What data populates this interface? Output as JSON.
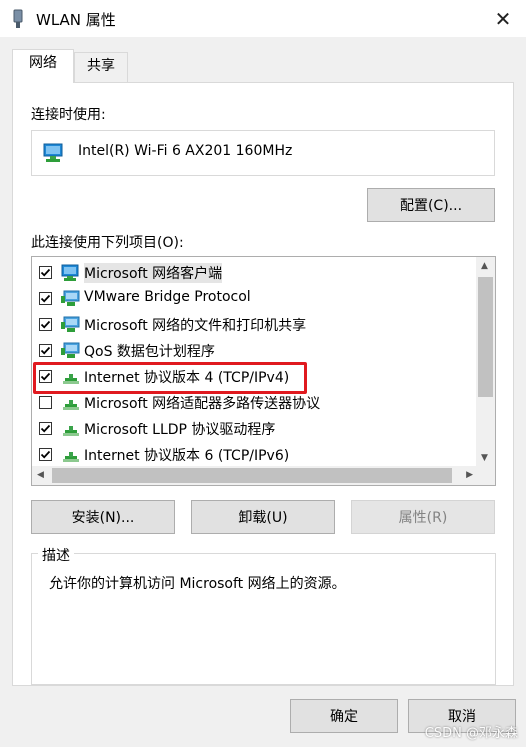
{
  "window": {
    "title": "WLAN 属性",
    "close_glyph": "✕"
  },
  "tabs": [
    {
      "label": "网络",
      "active": true
    },
    {
      "label": "共享",
      "active": false
    }
  ],
  "connect_using_label": "连接时使用:",
  "adapter": {
    "name": "Intel(R) Wi-Fi 6 AX201 160MHz",
    "icon": "network-adapter-icon"
  },
  "configure_button": "配置(C)...",
  "items_label": "此连接使用下列项目(O):",
  "items": [
    {
      "label": "Microsoft 网络客户端",
      "checked": true,
      "icon": "network-client-icon"
    },
    {
      "label": "VMware Bridge Protocol",
      "checked": true,
      "icon": "network-service-icon"
    },
    {
      "label": "Microsoft 网络的文件和打印机共享",
      "checked": true,
      "icon": "network-service-icon"
    },
    {
      "label": "QoS 数据包计划程序",
      "checked": true,
      "icon": "network-service-icon"
    },
    {
      "label": "Internet 协议版本 4 (TCP/IPv4)",
      "checked": true,
      "icon": "protocol-icon"
    },
    {
      "label": "Microsoft 网络适配器多路传送器协议",
      "checked": false,
      "icon": "protocol-icon"
    },
    {
      "label": "Microsoft LLDP 协议驱动程序",
      "checked": true,
      "icon": "protocol-icon"
    },
    {
      "label": "Internet 协议版本 6 (TCP/IPv6)",
      "checked": true,
      "icon": "protocol-icon"
    }
  ],
  "buttons": {
    "install": "安装(N)...",
    "uninstall": "卸载(U)",
    "properties": "属性(R)",
    "ok": "确定",
    "cancel": "取消"
  },
  "description": {
    "legend": "描述",
    "text": "允许你的计算机访问 Microsoft 网络上的资源。"
  },
  "watermark": "CSDN @邓永森",
  "colors": {
    "highlight_border": "#e0191f",
    "icon_blue": "#1e88d6",
    "icon_green": "#2e9e3a"
  }
}
